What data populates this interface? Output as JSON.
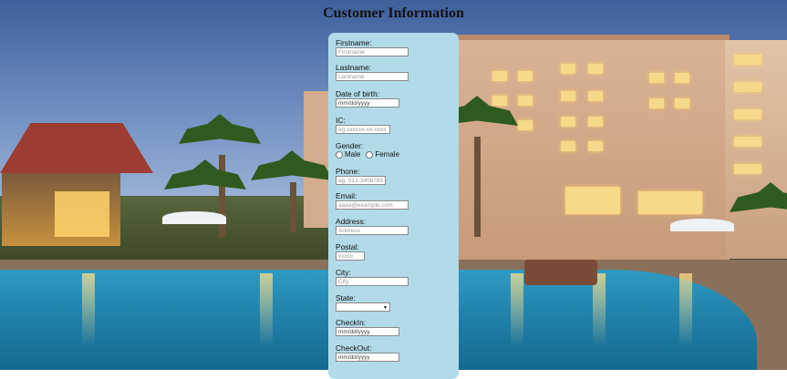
{
  "page": {
    "title": "Customer Information"
  },
  "form": {
    "firstname": {
      "label": "Firstname:",
      "placeholder": "Firstname"
    },
    "lastname": {
      "label": "Lastname:",
      "placeholder": "Lastname"
    },
    "dob": {
      "label": "Date of birth:",
      "value": "mm/dd/yyyy"
    },
    "ic": {
      "label": "IC:",
      "placeholder": "eg:xxxxxx-xx-xxxx"
    },
    "gender": {
      "label": "Gender:",
      "options": [
        "Male",
        "Female"
      ]
    },
    "phone": {
      "label": "Phone:",
      "placeholder": "eg. 012-3456789"
    },
    "email": {
      "label": "Email:",
      "placeholder": "aaaa@example.com"
    },
    "address": {
      "label": "Address:",
      "placeholder": "Address"
    },
    "postal": {
      "label": "Postal:",
      "placeholder": "xxxxx"
    },
    "city": {
      "label": "City:",
      "placeholder": "City"
    },
    "state": {
      "label": "State:",
      "value": ""
    },
    "checkin": {
      "label": "CheckIn:",
      "value": "mm/dd/yyyy"
    },
    "checkout": {
      "label": "CheckOut:",
      "value": "mm/dd/yyyy"
    }
  },
  "icons": {
    "select_arrow": "chevron-down-icon"
  }
}
